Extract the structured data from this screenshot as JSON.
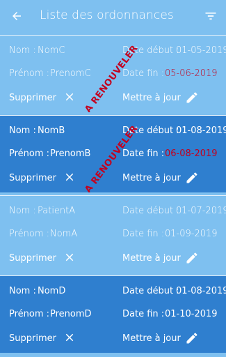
{
  "appbar": {
    "title": "Liste des ordonnances",
    "back_icon": "arrow-back-icon",
    "filter_icon": "filter-list-icon"
  },
  "labels": {
    "nom": "Nom :",
    "prenom": "Prénom :",
    "date_debut": "Date début :",
    "date_fin": "Date fin :",
    "supprimer": "Supprimer",
    "mettre_a_jour": "Mettre à jour",
    "a_renouveler": "A RENOUVELER"
  },
  "colors": {
    "light_card": "#7ec0f0",
    "dark_card": "#2f7fcf",
    "alert": "#c2001f"
  },
  "prescriptions": [
    {
      "nom": "NomC",
      "prenom": "PrenomC",
      "date_debut": "01-05-2019",
      "date_fin": "05-06-2019",
      "a_renouveler": true,
      "style": "light"
    },
    {
      "nom": "NomB",
      "prenom": "PrenomB",
      "date_debut": "01-08-2019",
      "date_fin": "06-08-2019",
      "a_renouveler": true,
      "style": "dark"
    },
    {
      "nom": "PatientA",
      "prenom": "NomA",
      "date_debut": "01-07-2019",
      "date_fin": "01-09-2019",
      "a_renouveler": false,
      "style": "light"
    },
    {
      "nom": "NomD",
      "prenom": "PrenomD",
      "date_debut": "01-08-2019",
      "date_fin": "01-10-2019",
      "a_renouveler": false,
      "style": "dark"
    }
  ]
}
